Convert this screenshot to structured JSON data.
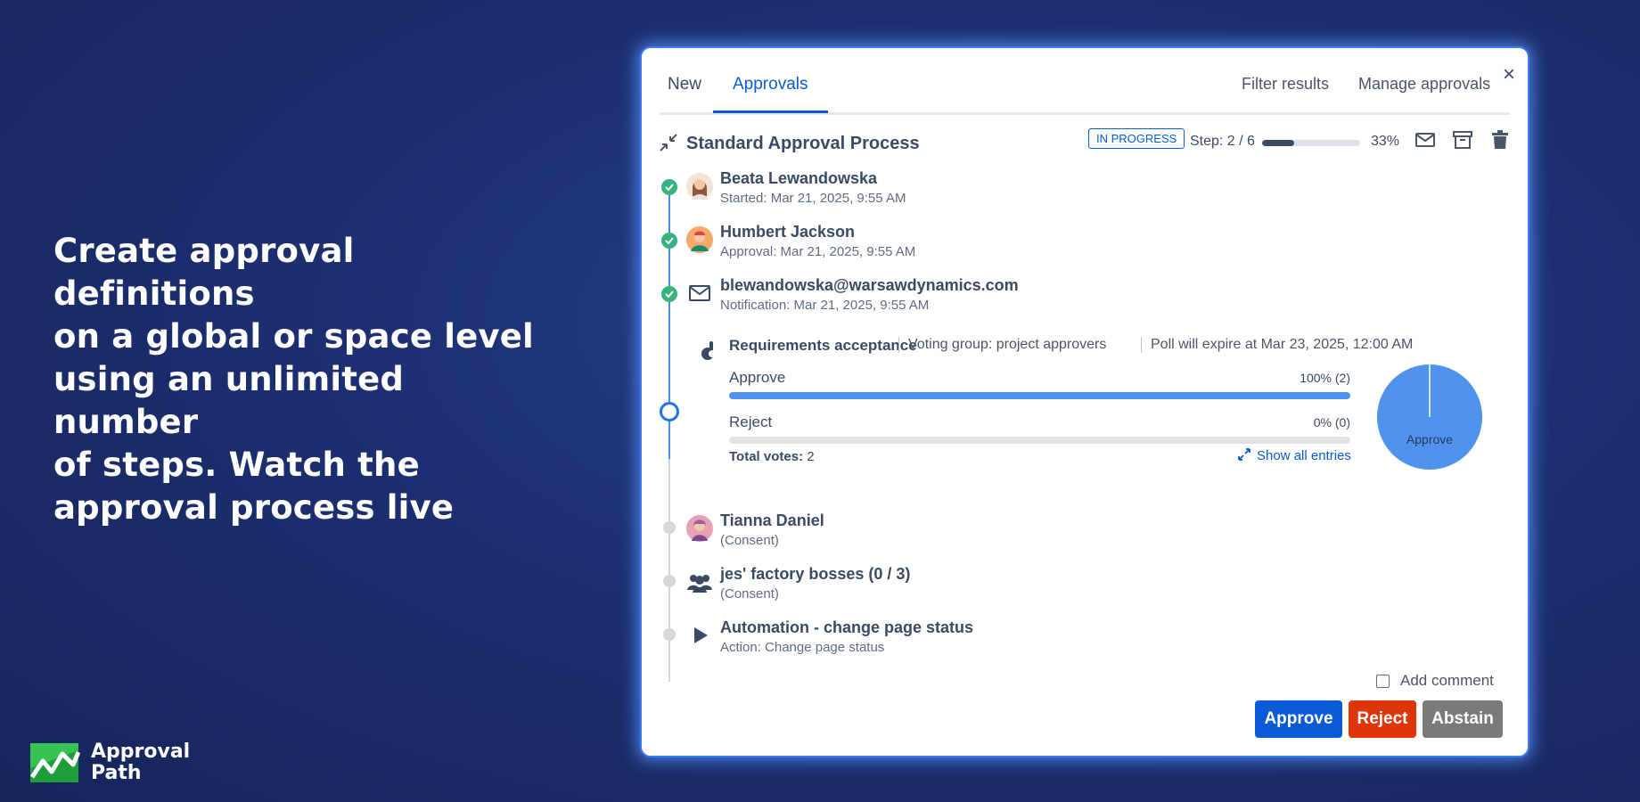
{
  "hero": {
    "line1": "Create approval definitions",
    "line2": "on a global or space level",
    "line3": "using an unlimited number",
    "line4": "of steps. Watch the",
    "line5": "approval process live"
  },
  "logo": {
    "line1": "Approval",
    "line2": "Path"
  },
  "panel": {
    "close_label": "×",
    "tabs": [
      {
        "label": "New",
        "active": false
      },
      {
        "label": "Approvals",
        "active": true
      }
    ],
    "actions": {
      "filter": "Filter results",
      "manage": "Manage approvals"
    },
    "process": {
      "title": "Standard Approval Process",
      "status": "IN PROGRESS",
      "step_label": "Step: 2 / 6",
      "progress": 0.33,
      "progress_label": "33%"
    },
    "steps": [
      {
        "name": "Beata Lewandowska",
        "sub": "Started: Mar 21, 2025, 9:55 AM",
        "state": "done"
      },
      {
        "name": "Humbert Jackson",
        "sub": "Approval: Mar 21, 2025, 9:55 AM",
        "state": "done"
      },
      {
        "name": "blewandowska@warsawdynamics.com",
        "sub": "Notification: Mar 21, 2025, 9:55 AM",
        "state": "done"
      },
      {
        "name": "Tianna Daniel",
        "sub": "(Consent)",
        "state": "pending"
      },
      {
        "name": "jes' factory bosses (0 / 3)",
        "sub": "(Consent)",
        "state": "pending"
      },
      {
        "name": "Automation - change page status",
        "sub": "Action: Change page status",
        "state": "pending"
      }
    ],
    "poll": {
      "title": "Requirements acceptance",
      "group": "Voting group: project approvers",
      "expire": "Poll will expire at Mar 23, 2025, 12:00 AM",
      "options": [
        {
          "label": "Approve",
          "value_label": "100% (2)",
          "fraction": 1.0
        },
        {
          "label": "Reject",
          "value_label": "0% (0)",
          "fraction": 0.0
        }
      ],
      "total_label": "Total votes:",
      "total_value": "2",
      "show_all": "Show all entries",
      "pie_label": "Approve",
      "pie_color": "#4f93ef"
    },
    "comment_label": "Add comment",
    "buttons": {
      "approve": "Approve",
      "reject": "Reject",
      "abstain": "Abstain"
    },
    "colors": {
      "primary": "#0b5bd6",
      "success": "#36b37e",
      "danger": "#de350b",
      "neutral": "#7a7a7a"
    }
  }
}
